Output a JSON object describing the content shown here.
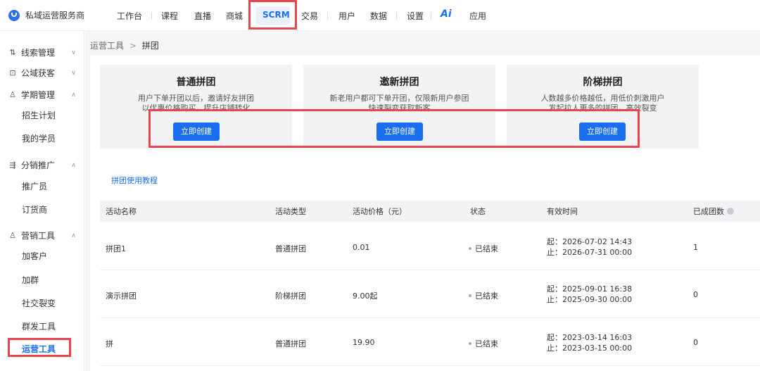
{
  "brand": {
    "name": "私域运营服务商"
  },
  "nav": {
    "items": [
      "工作台",
      "课程",
      "直播",
      "商城",
      "SCRM",
      "交易",
      "用户",
      "数据",
      "设置",
      "应用"
    ],
    "ai_label": "Ai",
    "active": "SCRM"
  },
  "sidebar": {
    "groups": [
      {
        "icon": "leads-icon",
        "label": "线索管理",
        "expanded": false
      },
      {
        "icon": "public-domain-icon",
        "label": "公域获客",
        "expanded": false
      },
      {
        "icon": "user-icon",
        "label": "学期管理",
        "expanded": true,
        "items": [
          "招生计划",
          "我的学员"
        ]
      },
      {
        "icon": "share-icon",
        "label": "分销推广",
        "expanded": true,
        "items": [
          "推广员",
          "订货商"
        ]
      },
      {
        "icon": "user-icon",
        "label": "营销工具",
        "expanded": true,
        "items": [
          "加客户",
          "加群",
          "社交裂变",
          "群发工具",
          "运营工具"
        ]
      }
    ],
    "active_item": "运营工具"
  },
  "breadcrumb": {
    "parent": "运营工具",
    "separator": ">",
    "current": "拼团"
  },
  "cards": [
    {
      "title": "普通拼团",
      "desc_line1": "用户下单开团以后，邀请好友拼团",
      "desc_line2": "以优惠价格购买，提升店铺转化",
      "button": "立即创建"
    },
    {
      "title": "邀新拼团",
      "desc_line1": "新老用户都可下单开团，仅限新用户参团",
      "desc_line2": "快速裂变获取新客",
      "button": "立即创建"
    },
    {
      "title": "阶梯拼团",
      "desc_line1": "人数越多价格越低，用低价刺激用户",
      "desc_line2": "发起拉人更多的拼团，高效裂变",
      "button": "立即创建"
    }
  ],
  "tutorial_link": "拼团使用教程",
  "table": {
    "columns": [
      "活动名称",
      "活动类型",
      "活动价格（元）",
      "状态",
      "有效时间",
      "已成团数"
    ],
    "rows": [
      {
        "name": "拼团1",
        "type": "普通拼团",
        "price": "0.01",
        "status": "已结束",
        "start": "起：2026-07-02 14:43",
        "end": "止：2026-07-31 00:00",
        "groups": "1"
      },
      {
        "name": "演示拼团",
        "type": "阶梯拼团",
        "price": "9.00起",
        "status": "已结束",
        "start": "起：2025-09-01 16:38",
        "end": "止：2025-09-30 00:00",
        "groups": "0"
      },
      {
        "name": "拼",
        "type": "普通拼团",
        "price": "19.90",
        "status": "已结束",
        "start": "起：2023-03-14 16:03",
        "end": "止：2023-03-15 00:00",
        "groups": "0"
      }
    ]
  },
  "colors": {
    "accent": "#1a6ff0",
    "highlight": "#e8464c"
  }
}
